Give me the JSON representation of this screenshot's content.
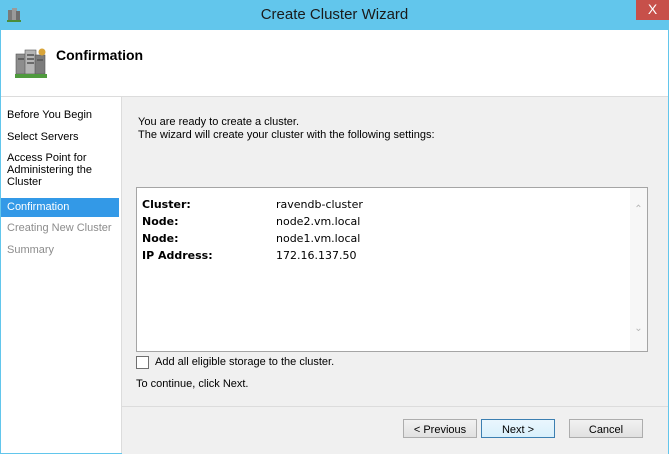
{
  "window": {
    "title": "Create Cluster Wizard",
    "close_label": "X"
  },
  "header": {
    "title": "Confirmation"
  },
  "nav": {
    "items": [
      {
        "label": "Before You Begin",
        "state": "normal"
      },
      {
        "label": "Select Servers",
        "state": "normal"
      },
      {
        "label": "Access Point for Administering the Cluster",
        "state": "normal"
      },
      {
        "label": "Confirmation",
        "state": "active"
      },
      {
        "label": "Creating New Cluster",
        "state": "disabled"
      },
      {
        "label": "Summary",
        "state": "disabled"
      }
    ]
  },
  "main": {
    "intro_line1": "You are ready to create a cluster.",
    "intro_line2": "The wizard will create your cluster with the following settings:",
    "settings": [
      {
        "key": "Cluster:",
        "value": "ravendb-cluster"
      },
      {
        "key": "Node:",
        "value": "node2.vm.local"
      },
      {
        "key": "Node:",
        "value": "node1.vm.local"
      },
      {
        "key": "IP Address:",
        "value": "172.16.137.50"
      }
    ],
    "storage_checkbox_label": "Add all eligible storage to the cluster.",
    "storage_checked": false,
    "continue_text": "To continue, click Next."
  },
  "buttons": {
    "previous": "< Previous",
    "next": "Next >",
    "cancel": "Cancel"
  },
  "colors": {
    "title_bar": "#62c6ec",
    "nav_active": "#3399e7",
    "close_button": "#c7504a"
  }
}
